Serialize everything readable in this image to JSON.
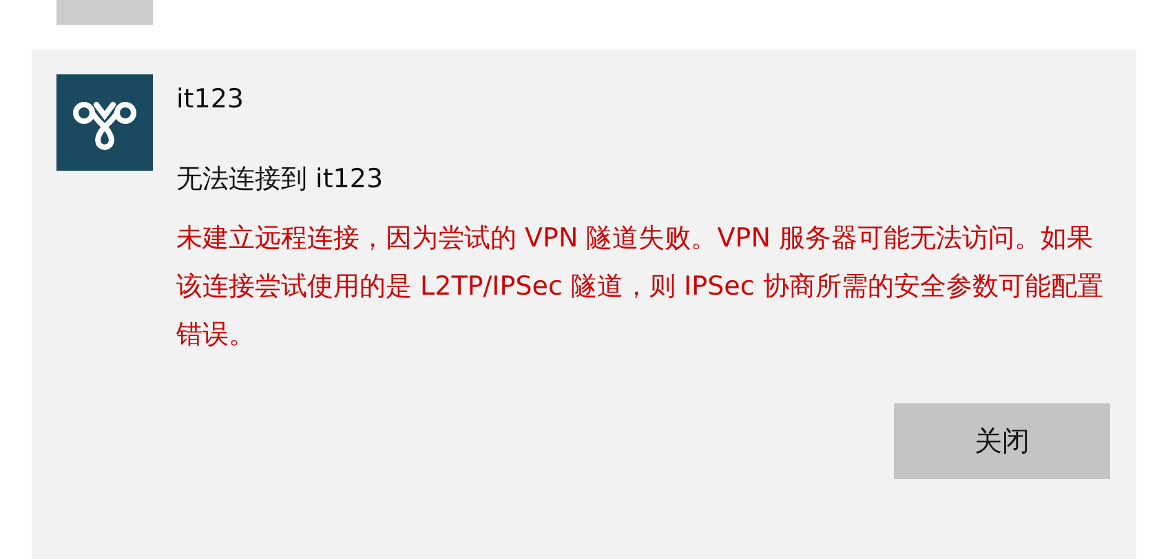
{
  "notification": {
    "app_name": "it123",
    "title": "无法连接到 it123",
    "message": "未建立远程连接，因为尝试的 VPN 隧道失败。VPN 服务器可能无法访问。如果该连接尝试使用的是 L2TP/IPSec 隧道，则 IPSec 协商所需的安全参数可能配置错误。",
    "buttons": [
      "关闭"
    ]
  }
}
